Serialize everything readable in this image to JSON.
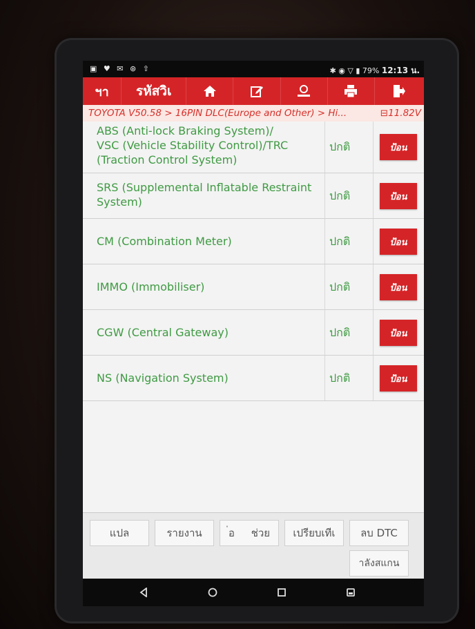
{
  "statusbar": {
    "left_icons": "▣ ♥ ✉ ⊛ ⇧",
    "right_icons": "✱ ◉ ▽ ▮",
    "battery": "79%",
    "time": "12:13 น."
  },
  "toolbar": {
    "back_label": "ฯา",
    "title": "รหัสวิเ",
    "icons": [
      "home-icon",
      "edit-icon",
      "user-icon",
      "print-icon",
      "exit-icon"
    ]
  },
  "breadcrumb": {
    "path": "TOYOTA V50.58 > 16PIN DLC(Europe and Other) > Hi...",
    "voltage": "11.82V"
  },
  "systems": [
    {
      "name_lines": [
        "ABS (Anti-lock Braking System)/",
        "VSC (Vehicle Stability Control)/TRC",
        "(Traction Control System)"
      ],
      "status": "ปกติ",
      "action": "ป้อน"
    },
    {
      "name_lines": [
        "SRS (Supplemental Inflatable Restraint",
        "System)"
      ],
      "status": "ปกติ",
      "action": "ป้อน"
    },
    {
      "name_lines": [
        "CM (Combination Meter)"
      ],
      "status": "ปกติ",
      "action": "ป้อน"
    },
    {
      "name_lines": [
        "IMMO (Immobiliser)"
      ],
      "status": "ปกติ",
      "action": "ป้อน"
    },
    {
      "name_lines": [
        "CGW (Central Gateway)"
      ],
      "status": "ปกติ",
      "action": "ป้อน"
    },
    {
      "name_lines": [
        "NS (Navigation System)"
      ],
      "status": "ปกติ",
      "action": "ป้อน"
    }
  ],
  "bottom_buttons": {
    "translate": "แปล",
    "report": "รายงาน",
    "info": "่อ",
    "help": "ช่วย",
    "compare": "เปรียบเทีเ",
    "clear_dtc": "ลบ DTC",
    "scanning": "าลังสแกน"
  },
  "colors": {
    "accent_red": "#d52427",
    "text_green": "#3f9a43",
    "breadcrumb_bg": "#fbe7e3"
  }
}
